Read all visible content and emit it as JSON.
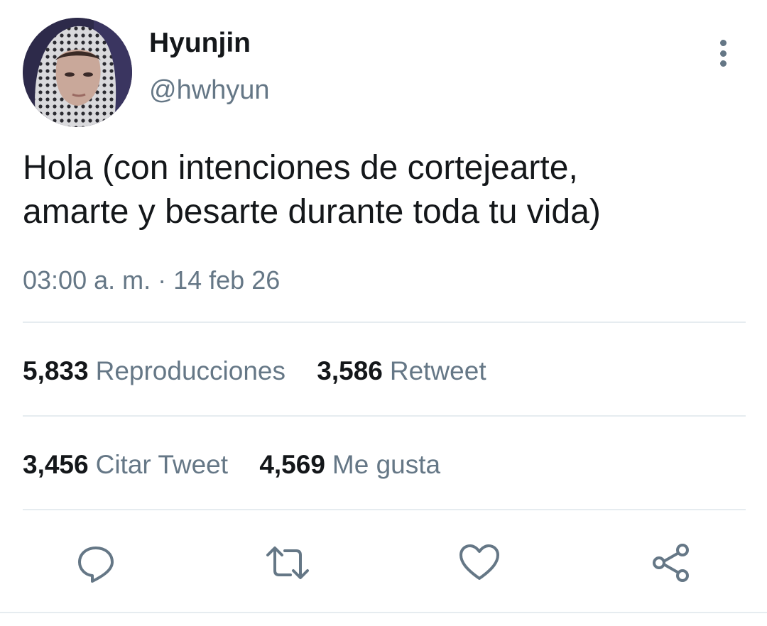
{
  "tweet": {
    "author": {
      "display_name": "Hyunjin",
      "handle": "@hwhyun"
    },
    "text_lines": [
      "Hola (con intenciones de cortejearte,",
      "amarte y besarte durante toda tu vida)"
    ],
    "timestamp": "03:00 a. m. · 14 feb 26",
    "stats": {
      "views": {
        "count": "5,833",
        "label": "Reproducciones"
      },
      "retweets": {
        "count": "3,586",
        "label": "Retweet"
      },
      "quotes": {
        "count": "3,456",
        "label": "Citar Tweet"
      },
      "likes": {
        "count": "4,569",
        "label": "Me gusta"
      }
    },
    "actions": [
      "reply-icon",
      "retweet-icon",
      "like-icon",
      "share-icon"
    ]
  },
  "colors": {
    "primary_text": "#14171a",
    "secondary_text": "#657786",
    "divider": "#e6ecf0"
  }
}
